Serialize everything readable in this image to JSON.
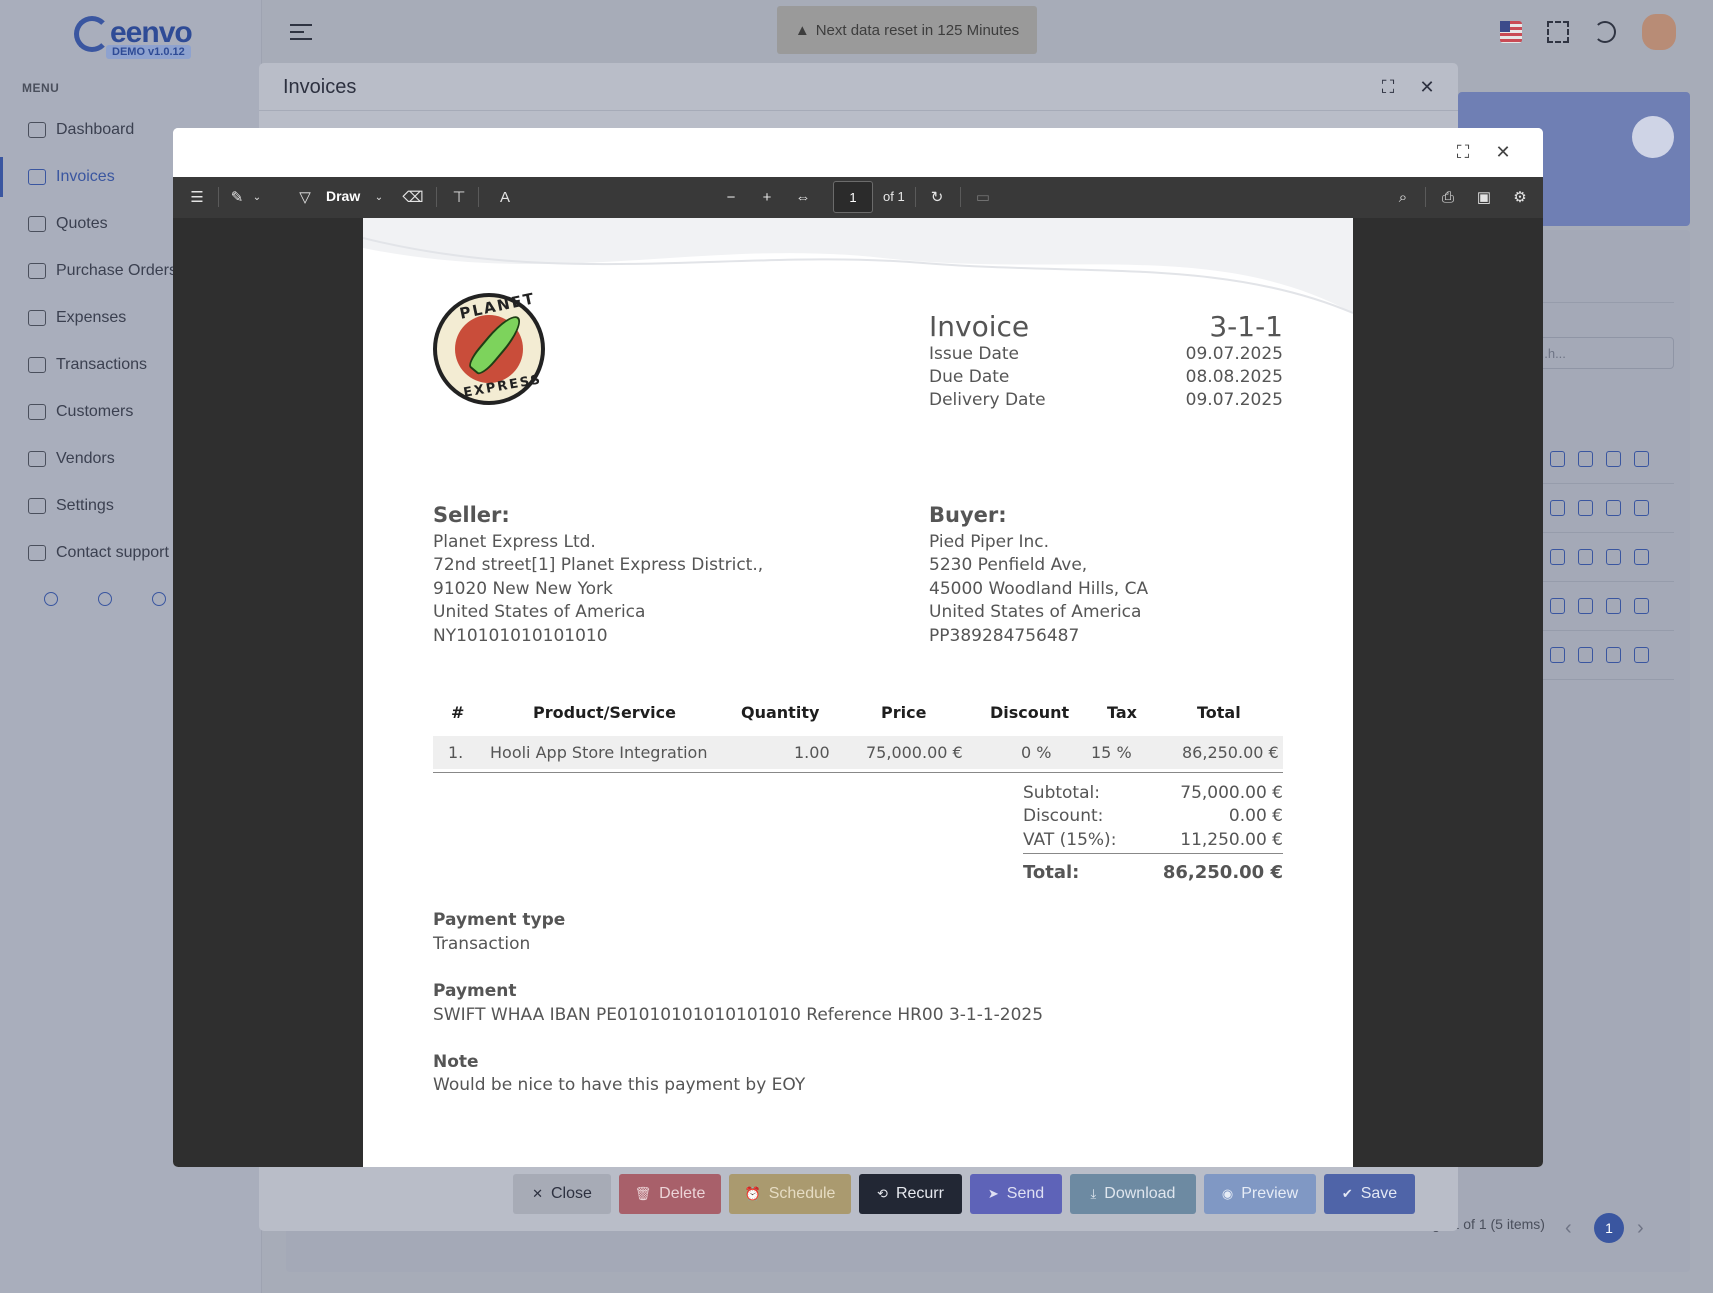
{
  "app": {
    "logo_text": "eenvo",
    "version_badge": "DEMO v1.0.12",
    "menu_label": "MENU"
  },
  "sidebar": {
    "items": [
      {
        "label": "Dashboard"
      },
      {
        "label": "Invoices"
      },
      {
        "label": "Quotes"
      },
      {
        "label": "Purchase Orders"
      },
      {
        "label": "Expenses"
      },
      {
        "label": "Transactions"
      },
      {
        "label": "Customers"
      },
      {
        "label": "Vendors"
      },
      {
        "label": "Settings"
      },
      {
        "label": "Contact support"
      }
    ]
  },
  "topbar": {
    "banner": "Next data reset in 125 Minutes",
    "banner_icon": "warning-icon"
  },
  "background": {
    "search_placeholder": "...h...",
    "pagination_text": "Page 1 of 1 (5 items)",
    "current_page": "1"
  },
  "invoices_dialog": {
    "title": "Invoices",
    "actions": {
      "close": "Close",
      "delete": "Delete",
      "schedule": "Schedule",
      "recurr": "Recurr",
      "send": "Send",
      "download": "Download",
      "preview": "Preview",
      "save": "Save"
    }
  },
  "pdf_viewer": {
    "draw_label": "Draw",
    "page_number": "1",
    "page_of": "of 1"
  },
  "invoice": {
    "title": "Invoice",
    "number": "3-1-1",
    "logo_top_text": "PLANET",
    "logo_bottom_text": "EXPRESS",
    "meta": [
      {
        "label": "Issue Date",
        "value": "09.07.2025"
      },
      {
        "label": "Due Date",
        "value": "08.08.2025"
      },
      {
        "label": "Delivery Date",
        "value": "09.07.2025"
      }
    ],
    "seller": {
      "heading": "Seller:",
      "lines": [
        "Planet Express Ltd.",
        "72nd street[1] Planet Express District.,",
        "91020 New New York",
        "United States of America",
        "NY10101010101010"
      ]
    },
    "buyer": {
      "heading": "Buyer:",
      "lines": [
        "Pied Piper Inc.",
        "5230 Penfield Ave,",
        "45000 Woodland Hills, CA",
        "United States of America",
        "PP389284756487"
      ]
    },
    "table": {
      "headers": [
        "#",
        "Product/Service",
        "Quantity",
        "Price",
        "Discount",
        "Tax",
        "Total"
      ],
      "rows": [
        [
          "1.",
          "Hooli App Store Integration",
          "1.00",
          "75,000.00 €",
          "0 %",
          "15 %",
          "86,250.00 €"
        ]
      ]
    },
    "summary": {
      "subtotal_label": "Subtotal:",
      "subtotal": "75,000.00 €",
      "discount_label": "Discount:",
      "discount": "0.00 €",
      "vat_label": "VAT (15%):",
      "vat": "11,250.00 €",
      "total_label": "Total:",
      "total": "86,250.00 €"
    },
    "payment_type": {
      "heading": "Payment type",
      "value": "Transaction"
    },
    "payment": {
      "heading": "Payment",
      "value": "SWIFT WHAA IBAN PE01010101010101010 Reference HR00 3-1-1-2025"
    },
    "note": {
      "heading": "Note",
      "value": "Would be nice to have this payment by EOY"
    }
  }
}
